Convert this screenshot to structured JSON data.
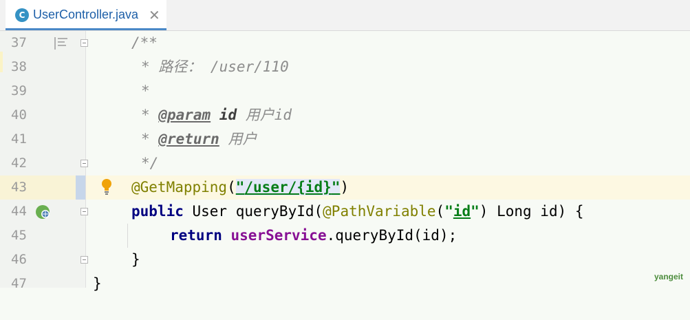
{
  "tab": {
    "icon_letter": "C",
    "title": "UserController.java",
    "close": "✕"
  },
  "line_numbers": [
    "37",
    "38",
    "39",
    "40",
    "41",
    "42",
    "43",
    "44",
    "45",
    "46",
    "47"
  ],
  "code": {
    "l37": "/**",
    "l38": "* 路径： /user/110",
    "l39": "*",
    "l40_star": "* ",
    "l40_tag": "@param",
    "l40_name": "id",
    "l40_desc": "用户id",
    "l41_star": "* ",
    "l41_tag": "@return",
    "l41_desc": "用户",
    "l42": "*/",
    "l43_ann": "@GetMapping",
    "l43_open": "(",
    "l43_q1": "\"",
    "l43_str": "/user/{id}",
    "l43_q2": "\"",
    "l43_close": ")",
    "l44_kw": "public",
    "l44_type": " User queryById(",
    "l44_ann": "@PathVariable",
    "l44_open": "(",
    "l44_q1": "\"",
    "l44_str": "id",
    "l44_q2": "\"",
    "l44_rest": ") Long id) {",
    "l45_kw": "return",
    "l45_field": "userService",
    "l45_rest": ".queryById(id);",
    "l46": "}",
    "l47": "}"
  },
  "watermark": "yangeit",
  "icons": [
    "java-class-icon",
    "close-icon",
    "doc-comment-icon",
    "lightbulb-icon",
    "spring-endpoint-icon",
    "fold-icon"
  ],
  "colors": {
    "annotation": "#808000",
    "keyword": "#000080",
    "string": "#067d17",
    "field": "#871094",
    "comment": "#8c8c8c",
    "tab_accent": "#4a88c7"
  }
}
